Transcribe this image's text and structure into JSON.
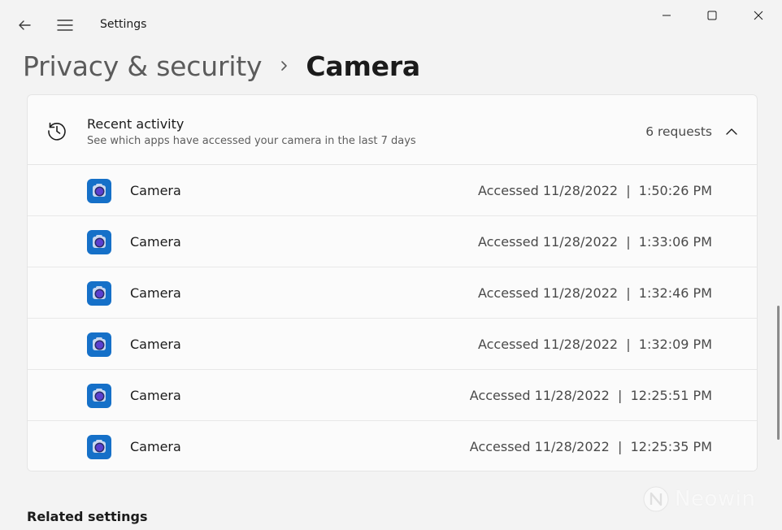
{
  "window": {
    "title": "Settings",
    "icons": {
      "back": "back-arrow-icon",
      "menu": "hamburger-menu-icon",
      "minimize": "minimize-icon",
      "maximize": "maximize-icon",
      "close": "close-icon"
    }
  },
  "breadcrumb": {
    "parent": "Privacy & security",
    "separator_icon": "chevron-right-icon",
    "current": "Camera"
  },
  "recent_activity": {
    "icon": "history-clock-icon",
    "title": "Recent activity",
    "subtitle": "See which apps have accessed your camera in the last 7 days",
    "count_label": "6 requests",
    "expanded": true,
    "items": [
      {
        "app": "Camera",
        "icon": "camera-app-icon",
        "accessed": "Accessed 11/28/2022  |  1:50:26 PM"
      },
      {
        "app": "Camera",
        "icon": "camera-app-icon",
        "accessed": "Accessed 11/28/2022  |  1:33:06 PM"
      },
      {
        "app": "Camera",
        "icon": "camera-app-icon",
        "accessed": "Accessed 11/28/2022  |  1:32:46 PM"
      },
      {
        "app": "Camera",
        "icon": "camera-app-icon",
        "accessed": "Accessed 11/28/2022  |  1:32:09 PM"
      },
      {
        "app": "Camera",
        "icon": "camera-app-icon",
        "accessed": "Accessed 11/28/2022  |  12:25:51 PM"
      },
      {
        "app": "Camera",
        "icon": "camera-app-icon",
        "accessed": "Accessed 11/28/2022  |  12:25:35 PM"
      }
    ]
  },
  "related_settings": {
    "title": "Related settings"
  },
  "watermark": {
    "text": "Neowin"
  },
  "colors": {
    "background": "#f3f3f3",
    "card": "#fbfbfb",
    "accent": "#1570c8"
  }
}
